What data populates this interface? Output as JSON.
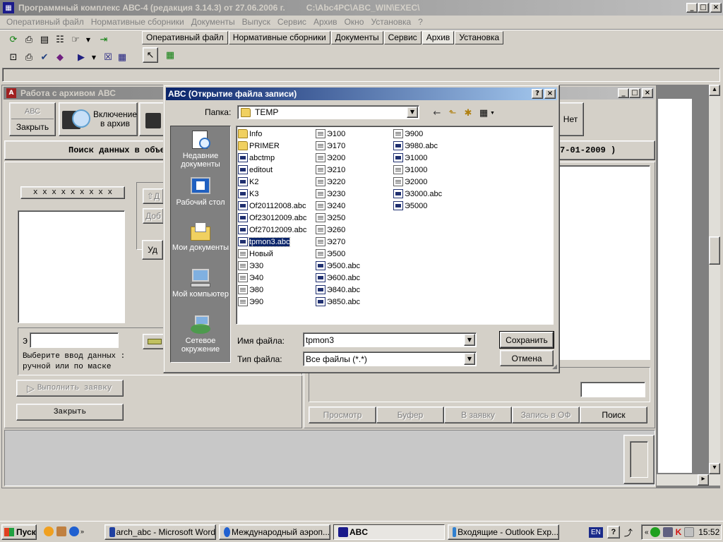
{
  "app": {
    "title": "Программный комплекс АВС-4 (редакция 3.14.3) от 27.06.2006 г.",
    "path": "C:\\Abc4PC\\ABC_WIN\\EXEC\\",
    "menu": [
      "Оперативный файл",
      "Нормативные сборники",
      "Документы",
      "Выпуск",
      "Сервис",
      "Архив",
      "Окно",
      "Установка",
      "?"
    ],
    "tabs": [
      "Оперативный файл",
      "Нормативные сборники",
      "Документы",
      "Сервис",
      "Архив",
      "Установка"
    ],
    "active_tab": "Архив"
  },
  "archive_window": {
    "title": "Работа с архивом АВС",
    "close_btn_top": "АВС",
    "close_btn_bottom": "Закрыть",
    "include_btn_line1": "Включение",
    "include_btn_line2": "в архив",
    "no_btn": "Нет",
    "search_header_left": "Поиск данных в объе",
    "search_header_right": "7-01-2009 )",
    "mask": "х х х х х х х х х",
    "partial_btn1": "Д",
    "partial_btn2": "Доб",
    "partial_btn3": "Уд",
    "e_label": "Э",
    "hint_line1": "Выберите ввод данных :",
    "hint_line2": "ручной или по маске",
    "execute_btn": "Выполнить заявку",
    "close_btn": "Закрыть",
    "right_buttons": [
      "Просмотр",
      "Буфер",
      "В заявку",
      "Запись в ОФ",
      "Поиск"
    ]
  },
  "dialog": {
    "title": "АВС (Открытие файла записи)",
    "folder_label": "Папка:",
    "folder_value": "TEMP",
    "places": [
      "Недавние документы",
      "Рабочий стол",
      "Мои документы",
      "Мой компьютер",
      "Сетевое окружение"
    ],
    "files": [
      {
        "name": "Info",
        "type": "folder"
      },
      {
        "name": "PRIMER",
        "type": "folder"
      },
      {
        "name": "abctmp",
        "type": "abc"
      },
      {
        "name": "editout",
        "type": "abc"
      },
      {
        "name": "K2",
        "type": "abc"
      },
      {
        "name": "K3",
        "type": "abc"
      },
      {
        "name": "Of20112008.abc",
        "type": "abc"
      },
      {
        "name": "Of23012009.abc",
        "type": "abc"
      },
      {
        "name": "Of27012009.abc",
        "type": "abc"
      },
      {
        "name": "tpmon3.abc",
        "type": "abc",
        "selected": true
      },
      {
        "name": "Новый",
        "type": "doc"
      },
      {
        "name": "Э30",
        "type": "doc"
      },
      {
        "name": "Э40",
        "type": "doc"
      },
      {
        "name": "Э80",
        "type": "doc"
      },
      {
        "name": "Э90",
        "type": "doc"
      },
      {
        "name": "Э100",
        "type": "doc"
      },
      {
        "name": "Э170",
        "type": "doc"
      },
      {
        "name": "Э200",
        "type": "doc"
      },
      {
        "name": "Э210",
        "type": "doc"
      },
      {
        "name": "Э220",
        "type": "doc"
      },
      {
        "name": "Э230",
        "type": "doc"
      },
      {
        "name": "Э240",
        "type": "doc"
      },
      {
        "name": "Э250",
        "type": "doc"
      },
      {
        "name": "Э260",
        "type": "doc"
      },
      {
        "name": "Э270",
        "type": "doc"
      },
      {
        "name": "Э500",
        "type": "doc"
      },
      {
        "name": "Э500.abc",
        "type": "abc"
      },
      {
        "name": "Э600.abc",
        "type": "abc"
      },
      {
        "name": "Э840.abc",
        "type": "abc"
      },
      {
        "name": "Э850.abc",
        "type": "abc"
      },
      {
        "name": "Э900",
        "type": "doc"
      },
      {
        "name": "Э980.abc",
        "type": "abc"
      },
      {
        "name": "Э1000",
        "type": "abc"
      },
      {
        "name": "Э1000",
        "type": "doc"
      },
      {
        "name": "Э2000",
        "type": "doc"
      },
      {
        "name": "Э3000.abc",
        "type": "abc"
      },
      {
        "name": "Э5000",
        "type": "abc"
      }
    ],
    "filename_label": "Имя файла:",
    "filename_value": "tpmon3",
    "filetype_label": "Тип файла:",
    "filetype_value": "Все файлы (*.*)",
    "save_btn": "Сохранить",
    "cancel_btn": "Отмена"
  },
  "taskbar": {
    "start": "Пуск",
    "tasks": [
      "arch_abc - Microsoft Word",
      "Международный аэроп...",
      "ABC",
      "Входящие - Outlook Exp..."
    ],
    "active_task": "ABC",
    "lang": "EN",
    "clock": "15:52"
  }
}
